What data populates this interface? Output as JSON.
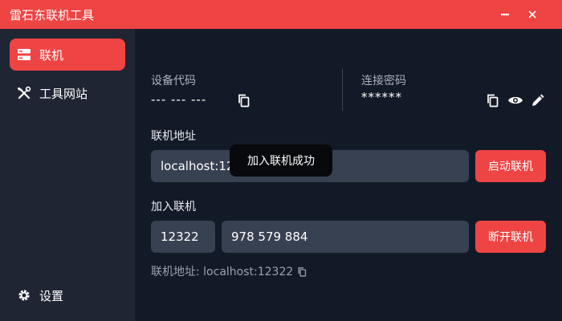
{
  "window": {
    "title": "雷石东联机工具"
  },
  "sidebar": {
    "items": [
      {
        "label": "联机",
        "icon": "server-icon",
        "active": true
      },
      {
        "label": "工具网站",
        "icon": "tools-icon",
        "active": false
      }
    ],
    "settings_label": "设置"
  },
  "device": {
    "label": "设备代码",
    "value": "--- --- ---"
  },
  "password": {
    "label": "连接密码",
    "value": "******"
  },
  "host": {
    "label": "联机地址",
    "address": "localhost:12322",
    "start_button": "启动联机"
  },
  "join": {
    "label": "加入联机",
    "port": "12322",
    "code": "978 579 884",
    "disconnect_button": "断开联机"
  },
  "toast": {
    "message": "加入联机成功"
  },
  "footer": {
    "address": "联机地址: localhost:12322"
  },
  "colors": {
    "accent": "#ef4444",
    "sidebar": "#1f2533",
    "main": "#131a27",
    "field": "#374152"
  }
}
